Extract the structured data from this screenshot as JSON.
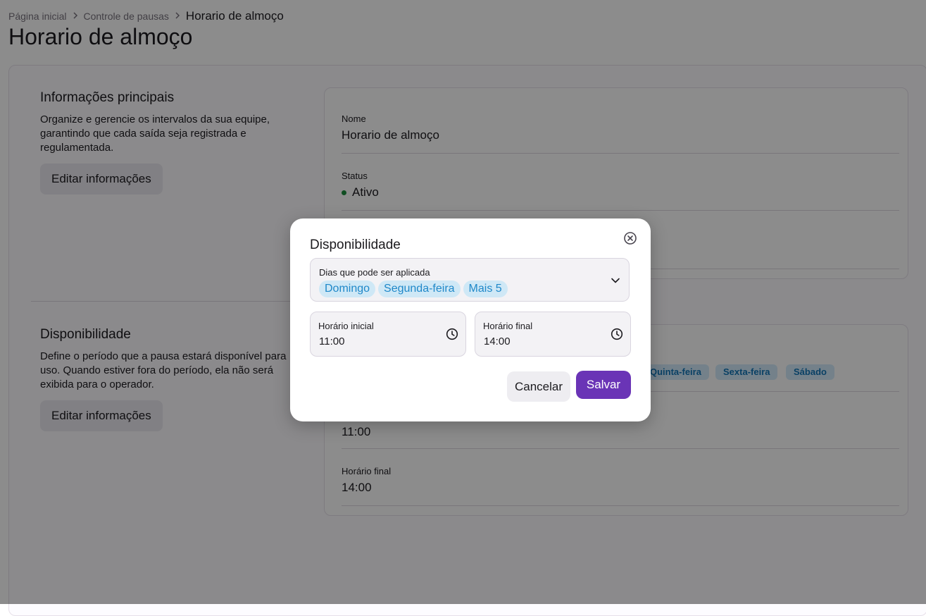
{
  "breadcrumb": {
    "items": [
      "Página inicial",
      "Controle de pausas"
    ],
    "current": "Horario de almoço",
    "separator": ">"
  },
  "page_title": "Horario de almoço",
  "main_info": {
    "heading": "Informações principais",
    "description": "Organize e gerencie os intervalos da sua equipe, garantindo que cada saída seja registrada e regulamentada.",
    "edit_button": "Editar informações",
    "fields": {
      "name_label": "Nome",
      "name_value": "Horario de almoço",
      "status_label": "Status",
      "status_value": "Ativo"
    }
  },
  "availability": {
    "heading": "Disponibilidade",
    "description": "Define o período que a pausa estará disponível para uso. Quando estiver fora do período, ela não será exibida para o operador.",
    "edit_button": "Editar informações",
    "days": [
      "Quinta-feira",
      "Sexta-feira",
      "Sábado"
    ],
    "start_value": "11:00",
    "end_label": "Horário final",
    "end_value": "14:00"
  },
  "dialog": {
    "title": "Disponibilidade",
    "days_label": "Dias que pode ser aplicada",
    "chips": [
      "Domingo",
      "Segunda-feira",
      "Mais 5"
    ],
    "start_label": "Horário inicial",
    "start_value": "11:00",
    "end_label": "Horário final",
    "end_value": "14:00",
    "cancel_label": "Cancelar",
    "save_label": "Salvar"
  },
  "icons": {
    "close": "close-circle-icon",
    "dropdown": "chevron-down-icon",
    "clock": "clock-icon",
    "breadcrumb_separator": "chevron-right-icon"
  },
  "colors": {
    "primary": "#6a34b6",
    "status_active": "#1e8e3e",
    "chip_text": "#1f88c9",
    "chip_bg": "#cfe8f6"
  }
}
